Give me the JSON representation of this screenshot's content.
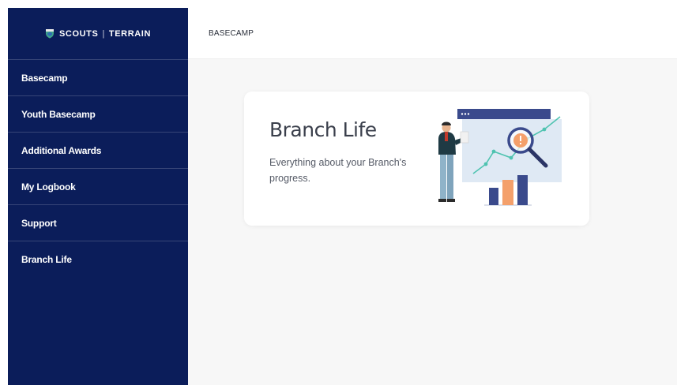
{
  "brand": {
    "name_left": "SCOUTS",
    "separator": "|",
    "name_right": "TERRAIN"
  },
  "sidebar": {
    "items": [
      {
        "label": "Basecamp"
      },
      {
        "label": "Youth Basecamp"
      },
      {
        "label": "Additional Awards"
      },
      {
        "label": "My Logbook"
      },
      {
        "label": "Support"
      },
      {
        "label": "Branch Life"
      }
    ]
  },
  "header": {
    "breadcrumb": "BASECAMP"
  },
  "card": {
    "title": "Branch Life",
    "description": "Everything about your Branch's progress.",
    "illustration_icon": "analytics-magnifier-illustration"
  },
  "colors": {
    "sidebar_bg": "#0b1d5a",
    "content_bg": "#f7f7f7",
    "card_bg": "#ffffff",
    "accent_teal": "#4fc3b0",
    "accent_orange": "#f4a06b",
    "accent_navy": "#3a4a8c"
  }
}
